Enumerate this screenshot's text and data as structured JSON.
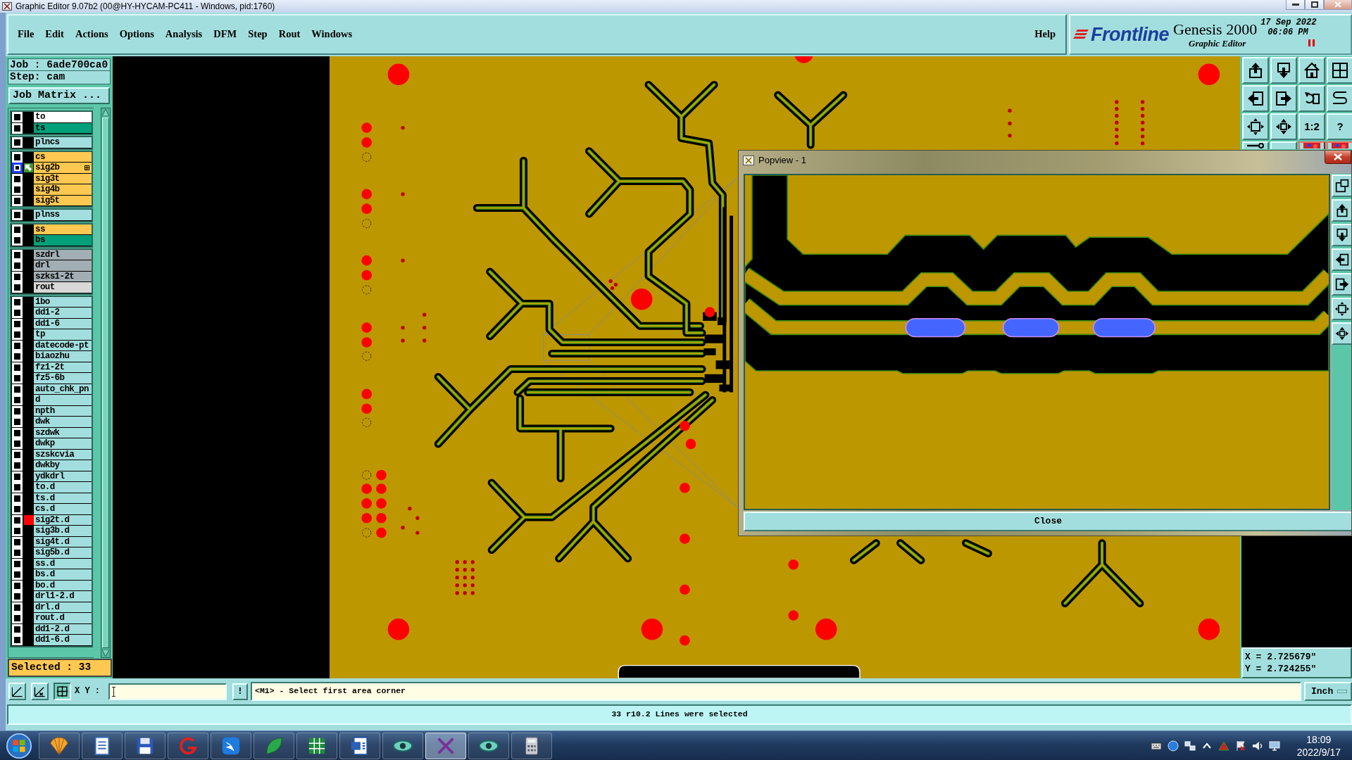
{
  "window": {
    "title": "Graphic Editor 9.07b2 (00@HY-HYCAM-PC411 - Windows, pid:1760)"
  },
  "menu": {
    "items": [
      "File",
      "Edit",
      "Actions",
      "Options",
      "Analysis",
      "DFM",
      "Step",
      "Rout",
      "Windows"
    ],
    "help": "Help"
  },
  "brand": {
    "logo": "Frontline",
    "product": "Genesis 2000",
    "subtitle": "Graphic Editor",
    "date": "17 Sep 2022",
    "time": "06:06 PM"
  },
  "job_panel": {
    "job": "Job : 6ade700ca0",
    "step": "Step: cam",
    "matrix_button": "Job Matrix ...",
    "selected_count": "Selected : 33"
  },
  "layer_groups": [
    {
      "layers": [
        {
          "name": "to",
          "color": "#ffffff",
          "checked": true,
          "focused": false,
          "work_layer": false,
          "displayed": false
        },
        {
          "name": "ts",
          "color": "#00a07a",
          "checked": true,
          "focused": false,
          "work_layer": false,
          "displayed": false
        }
      ]
    },
    {
      "layers": [
        {
          "name": "plncs",
          "color": "#a3dede",
          "checked": true,
          "focused": false,
          "work_layer": false,
          "displayed": false
        }
      ]
    },
    {
      "layers": [
        {
          "name": "cs",
          "color": "#ffc850",
          "checked": true,
          "focused": false,
          "work_layer": false,
          "displayed": false
        },
        {
          "name": "sig2b",
          "color": "#ffc850",
          "checked": true,
          "focused": true,
          "work_layer": true,
          "displayed": false
        },
        {
          "name": "sig3t",
          "color": "#ffc850",
          "checked": true,
          "focused": false,
          "work_layer": false,
          "displayed": false
        },
        {
          "name": "sig4b",
          "color": "#ffc850",
          "checked": true,
          "focused": false,
          "work_layer": false,
          "displayed": false
        },
        {
          "name": "sig5t",
          "color": "#ffc850",
          "checked": true,
          "focused": false,
          "work_layer": false,
          "displayed": false
        }
      ]
    },
    {
      "layers": [
        {
          "name": "plnss",
          "color": "#a3dede",
          "checked": true,
          "focused": false,
          "work_layer": false,
          "displayed": false
        }
      ]
    },
    {
      "layers": [
        {
          "name": "ss",
          "color": "#ffc850",
          "checked": true,
          "focused": false,
          "work_layer": false,
          "displayed": false
        },
        {
          "name": "bs",
          "color": "#00a07a",
          "checked": true,
          "focused": false,
          "work_layer": false,
          "displayed": false
        }
      ]
    },
    {
      "layers": [
        {
          "name": "szdrl",
          "color": "#a2aeb4",
          "checked": true,
          "focused": false,
          "work_layer": false,
          "displayed": false
        },
        {
          "name": "drl",
          "color": "#a2aeb4",
          "checked": true,
          "focused": false,
          "work_layer": false,
          "displayed": false
        },
        {
          "name": "szks1-2t",
          "color": "#a2aeb4",
          "checked": true,
          "focused": false,
          "work_layer": false,
          "displayed": false
        },
        {
          "name": "rout",
          "color": "#d8d8d8",
          "checked": true,
          "focused": false,
          "work_layer": false,
          "displayed": false
        }
      ]
    },
    {
      "layers": [
        {
          "name": "1bo",
          "color": "#a3dede",
          "checked": true,
          "focused": false,
          "work_layer": false,
          "displayed": false
        },
        {
          "name": "dd1-2",
          "color": "#a3dede",
          "checked": true,
          "focused": false,
          "work_layer": false,
          "displayed": false
        },
        {
          "name": "dd1-6",
          "color": "#a3dede",
          "checked": true,
          "focused": false,
          "work_layer": false,
          "displayed": false
        },
        {
          "name": "tp",
          "color": "#a3dede",
          "checked": true,
          "focused": false,
          "work_layer": false,
          "displayed": false
        },
        {
          "name": "datecode-pt",
          "color": "#a3dede",
          "checked": true,
          "focused": false,
          "work_layer": false,
          "displayed": false
        },
        {
          "name": "biaozhu",
          "color": "#a3dede",
          "checked": true,
          "focused": false,
          "work_layer": false,
          "displayed": false
        },
        {
          "name": "fz1-2t",
          "color": "#a3dede",
          "checked": true,
          "focused": false,
          "work_layer": false,
          "displayed": false
        },
        {
          "name": "fz5-6b",
          "color": "#a3dede",
          "checked": true,
          "focused": false,
          "work_layer": false,
          "displayed": false
        },
        {
          "name": "auto_chk_pn",
          "color": "#a3dede",
          "checked": true,
          "focused": false,
          "work_layer": false,
          "displayed": false
        },
        {
          "name": "d",
          "color": "#a3dede",
          "checked": true,
          "focused": false,
          "work_layer": false,
          "displayed": false
        },
        {
          "name": "npth",
          "color": "#a3dede",
          "checked": true,
          "focused": false,
          "work_layer": false,
          "displayed": false
        },
        {
          "name": "dwk",
          "color": "#a3dede",
          "checked": true,
          "focused": false,
          "work_layer": false,
          "displayed": false
        },
        {
          "name": "szdwk",
          "color": "#a3dede",
          "checked": true,
          "focused": false,
          "work_layer": false,
          "displayed": false
        },
        {
          "name": "dwkp",
          "color": "#a3dede",
          "checked": true,
          "focused": false,
          "work_layer": false,
          "displayed": false
        },
        {
          "name": "szskcvia",
          "color": "#a3dede",
          "checked": true,
          "focused": false,
          "work_layer": false,
          "displayed": false
        },
        {
          "name": "dwkby",
          "color": "#a3dede",
          "checked": true,
          "focused": false,
          "work_layer": false,
          "displayed": false
        },
        {
          "name": "ydkdrl",
          "color": "#a3dede",
          "checked": true,
          "focused": false,
          "work_layer": false,
          "displayed": false
        },
        {
          "name": "to.d",
          "color": "#a3dede",
          "checked": true,
          "focused": false,
          "work_layer": false,
          "displayed": false
        },
        {
          "name": "ts.d",
          "color": "#a3dede",
          "checked": true,
          "focused": false,
          "work_layer": false,
          "displayed": false
        },
        {
          "name": "cs.d",
          "color": "#a3dede",
          "checked": true,
          "focused": false,
          "work_layer": false,
          "displayed": false
        },
        {
          "name": "sig2t.d",
          "color": "#a3dede",
          "checked": true,
          "focused": false,
          "work_layer": false,
          "displayed": true
        },
        {
          "name": "sig3b.d",
          "color": "#a3dede",
          "checked": true,
          "focused": false,
          "work_layer": false,
          "displayed": false
        },
        {
          "name": "sig4t.d",
          "color": "#a3dede",
          "checked": true,
          "focused": false,
          "work_layer": false,
          "displayed": false
        },
        {
          "name": "sig5b.d",
          "color": "#a3dede",
          "checked": true,
          "focused": false,
          "work_layer": false,
          "displayed": false
        },
        {
          "name": "ss.d",
          "color": "#a3dede",
          "checked": true,
          "focused": false,
          "work_layer": false,
          "displayed": false
        },
        {
          "name": "bs.d",
          "color": "#a3dede",
          "checked": true,
          "focused": false,
          "work_layer": false,
          "displayed": false
        },
        {
          "name": "bo.d",
          "color": "#a3dede",
          "checked": true,
          "focused": false,
          "work_layer": false,
          "displayed": false
        },
        {
          "name": "drl1-2.d",
          "color": "#a3dede",
          "checked": true,
          "focused": false,
          "work_layer": false,
          "displayed": false
        },
        {
          "name": "drl.d",
          "color": "#a3dede",
          "checked": true,
          "focused": false,
          "work_layer": false,
          "displayed": false
        },
        {
          "name": "rout.d",
          "color": "#a3dede",
          "checked": true,
          "focused": false,
          "work_layer": false,
          "displayed": false
        },
        {
          "name": "dd1-2.d",
          "color": "#a3dede",
          "checked": true,
          "focused": false,
          "work_layer": false,
          "displayed": false
        },
        {
          "name": "dd1-6.d",
          "color": "#a3dede",
          "checked": true,
          "focused": false,
          "work_layer": false,
          "displayed": false
        }
      ]
    }
  ],
  "right_toolbar": {
    "scale_button": "1:2",
    "help_button": "?"
  },
  "coordinates": {
    "x": "X = 2.725679\"",
    "y": "Y = 2.724255\""
  },
  "popview": {
    "title": "Popview - 1",
    "close_button": "Close"
  },
  "command_line": {
    "tools": [
      {
        "selected": false
      },
      {
        "selected": false
      },
      {
        "selected": true
      }
    ],
    "xy_label": "X Y :",
    "prompt_button": "!",
    "message": "<M1> - Select first area corner",
    "units": "Inch"
  },
  "status_bar": {
    "message": "33 r10.2 Lines were selected"
  },
  "taskbar": {
    "apps": [
      {
        "selected": false
      },
      {
        "selected": false
      },
      {
        "selected": false
      },
      {
        "selected": false
      },
      {
        "selected": false
      },
      {
        "selected": false
      },
      {
        "selected": false
      },
      {
        "selected": false
      },
      {
        "selected": false
      },
      {
        "selected": true
      },
      {
        "selected": false
      },
      {
        "selected": false
      }
    ],
    "time": "18:09",
    "date": "2022/9/17"
  }
}
